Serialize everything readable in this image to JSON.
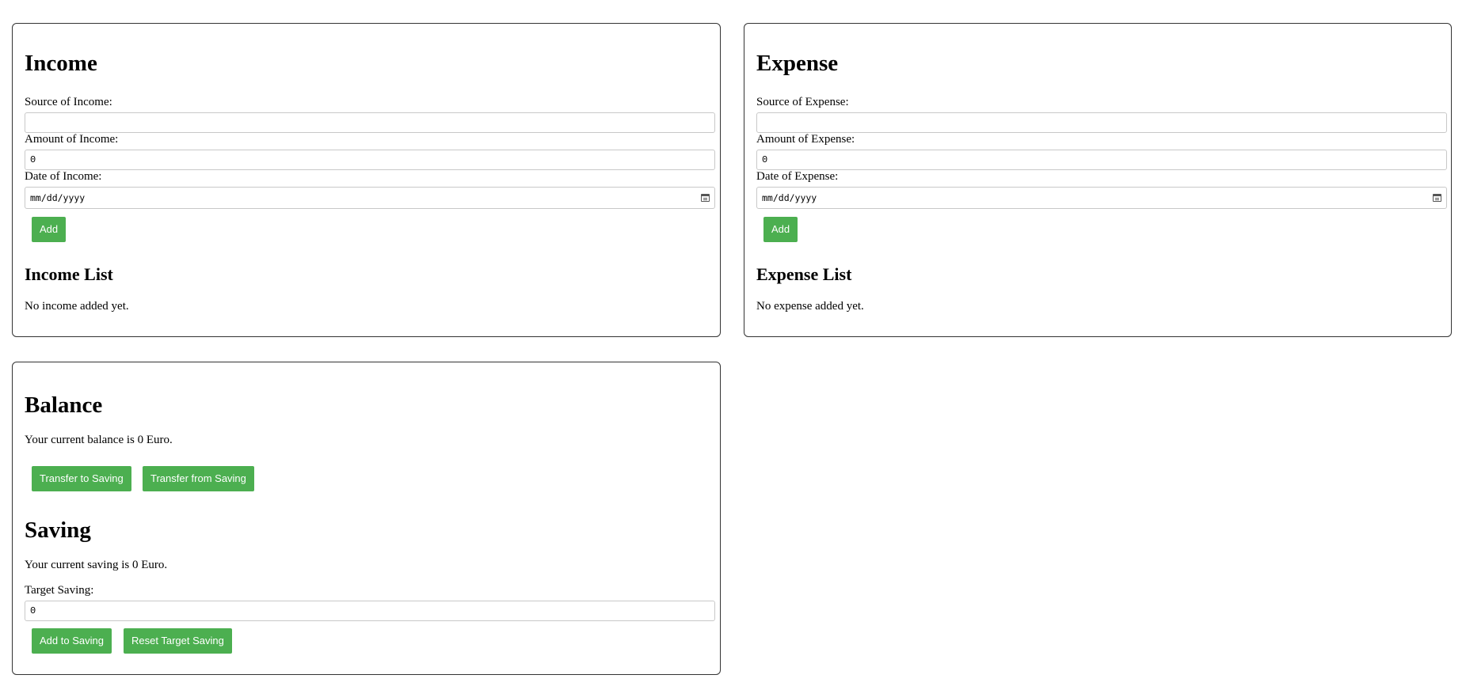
{
  "income": {
    "title": "Income",
    "source_label": "Source of Income:",
    "source_value": "",
    "amount_label": "Amount of Income:",
    "amount_value": "0",
    "date_label": "Date of Income:",
    "date_placeholder": "mm/dd/yyyy",
    "add_label": "Add",
    "list_title": "Income List",
    "empty_text": "No income added yet."
  },
  "expense": {
    "title": "Expense",
    "source_label": "Source of Expense:",
    "source_value": "",
    "amount_label": "Amount of Expense:",
    "amount_value": "0",
    "date_label": "Date of Expense:",
    "date_placeholder": "mm/dd/yyyy",
    "add_label": "Add",
    "list_title": "Expense List",
    "empty_text": "No expense added yet."
  },
  "balance": {
    "title": "Balance",
    "text": "Your current balance is 0 Euro.",
    "transfer_to_label": "Transfer to Saving",
    "transfer_from_label": "Transfer from Saving"
  },
  "saving": {
    "title": "Saving",
    "text": "Your current saving is 0 Euro.",
    "target_label": "Target Saving:",
    "target_value": "0",
    "add_label": "Add to Saving",
    "reset_label": "Reset Target Saving"
  },
  "colors": {
    "button_green": "#4caf50",
    "card_border": "#333333"
  }
}
